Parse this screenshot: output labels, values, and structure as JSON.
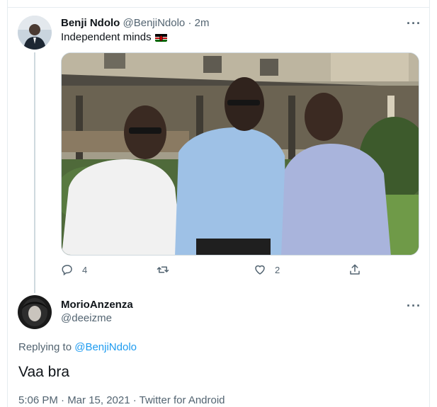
{
  "tweet": {
    "author_name": "Benji Ndolo",
    "author_handle": "@BenjiNdolo",
    "time_ago": "· 2m",
    "text": "Independent minds",
    "flag_icon": "kenya-flag-icon",
    "photo_icon": "group-photo",
    "actions": {
      "reply_count": "4",
      "retweet_count": "",
      "like_count": "2"
    }
  },
  "reply": {
    "author_name": "MorioAnzenza",
    "author_handle": "@deeizme",
    "replying_prefix": "Replying to",
    "replying_to": "@BenjiNdolo",
    "text": "Vaa bra",
    "timestamp": "5:06 PM · Mar 15, 2021 · Twitter for Android"
  },
  "colors": {
    "accent": "#1d9bf0",
    "muted": "#536471",
    "text": "#0f1419",
    "border": "#e6ecf0"
  }
}
